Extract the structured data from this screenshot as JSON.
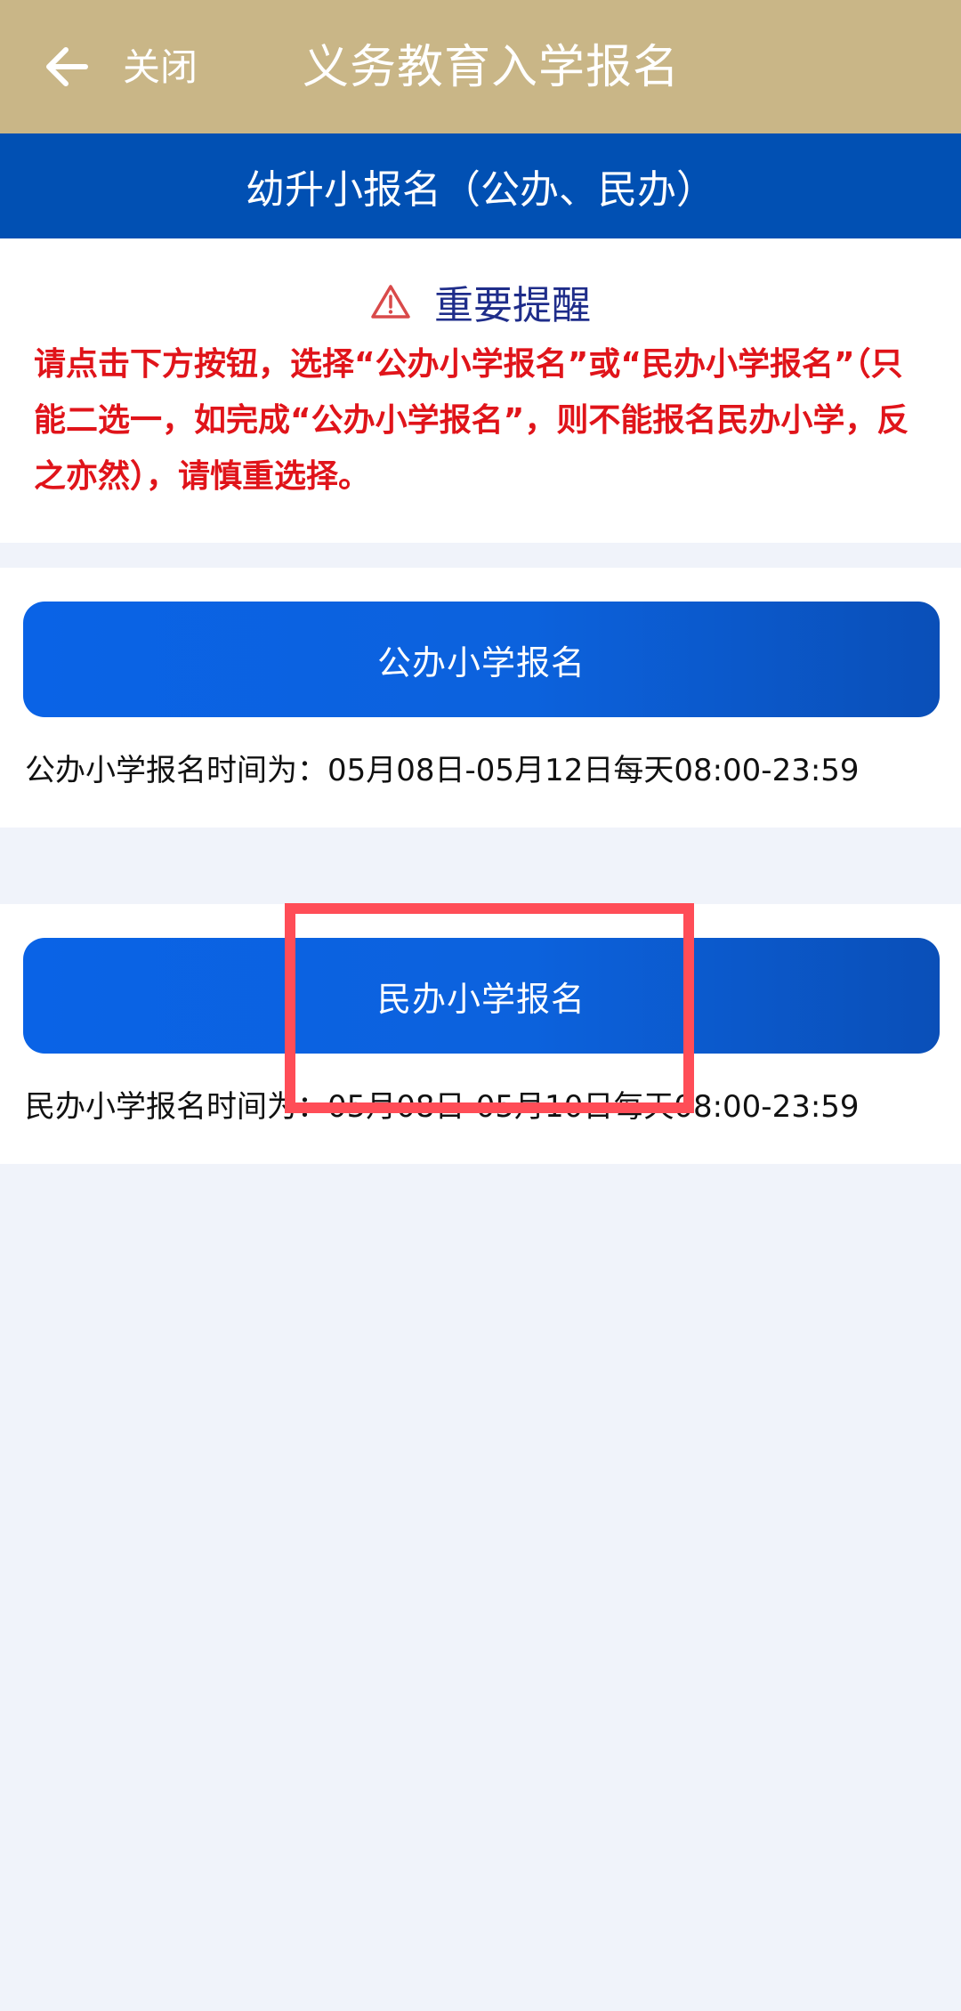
{
  "header": {
    "close_label": "关闭",
    "title": "义务教育入学报名"
  },
  "section_header": {
    "title": "幼升小报名（公办、民办）"
  },
  "notice": {
    "title": "重要提醒",
    "text": "请点击下方按钮，选择“公办小学报名”或“民办小学报名”（只能二选一，如完成“公办小学报名”，则不能报名民办小学，反之亦然），请慎重选择。"
  },
  "public_school": {
    "button_label": "公办小学报名",
    "time_text": "公办小学报名时间为：05月08日-05月12日每天08:00-23:59"
  },
  "private_school": {
    "button_label": "民办小学报名",
    "time_text": "民办小学报名时间为：05月08日-05月10日每天08:00-23:59"
  },
  "colors": {
    "topbar": "#c9b687",
    "section_header": "#0150b3",
    "button_blue": "#0a63e6",
    "notice_red": "#e0141a",
    "notice_title_blue": "#1f2d8a",
    "highlight_red": "#ff4d57",
    "page_bg": "#f0f3fa"
  },
  "icons": {
    "back": "arrow-left-icon",
    "warning": "warning-triangle-icon"
  }
}
